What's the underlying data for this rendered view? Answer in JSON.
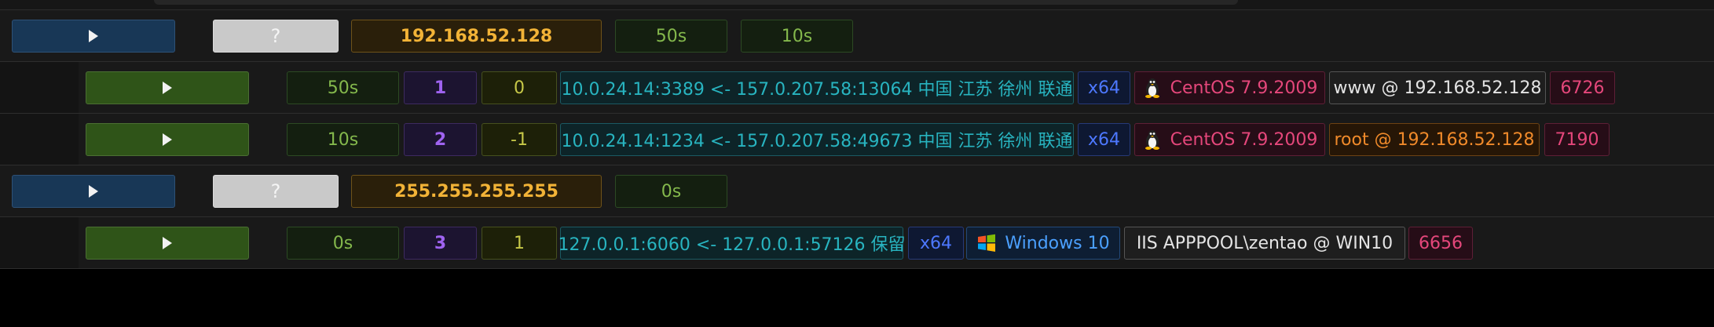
{
  "hosts": [
    {
      "ip": "192.168.52.128",
      "unknown_label": "?",
      "timers": [
        "50s",
        "10s"
      ],
      "sessions": [
        {
          "timer": "50s",
          "index": "1",
          "level": "0",
          "connection": "10.0.24.14:3389 <- 157.0.207.58:13064 中国 江苏 徐州 联通",
          "arch": "x64",
          "os": "CentOS 7.9.2009",
          "os_icon": "linux-penguin-icon",
          "user": "www @ 192.168.52.128",
          "pid": "6726"
        },
        {
          "timer": "10s",
          "index": "2",
          "level": "-1",
          "connection": "10.0.24.14:1234 <- 157.0.207.58:49673 中国 江苏 徐州 联通",
          "arch": "x64",
          "os": "CentOS 7.9.2009",
          "os_icon": "linux-penguin-icon",
          "user": "root @ 192.168.52.128",
          "pid": "7190"
        }
      ]
    },
    {
      "ip": "255.255.255.255",
      "unknown_label": "?",
      "timers": [
        "0s"
      ],
      "sessions": [
        {
          "timer": "0s",
          "index": "3",
          "level": "1",
          "connection": "127.0.0.1:6060 <- 127.0.0.1:57126 保留",
          "arch": "x64",
          "os": "Windows 10",
          "os_icon": "windows-logo-icon",
          "user": "IIS APPPOOL\\zentao @ WIN10",
          "pid": "6656"
        }
      ]
    }
  ],
  "colors": {
    "background": "#000000",
    "row": "#191919",
    "host_play": "#183756",
    "session_play": "#2f5418",
    "ip_text": "#f2b337",
    "timer_text": "#84b84c",
    "index_text": "#9f63f0",
    "level_text": "#c7c848",
    "connection_text": "#28b4c0",
    "arch_text": "#4d78ff",
    "linux_text": "#e5477b",
    "windows_text": "#4ba0ff",
    "root_text": "#f08a2a",
    "pid_text": "#e5477b"
  }
}
